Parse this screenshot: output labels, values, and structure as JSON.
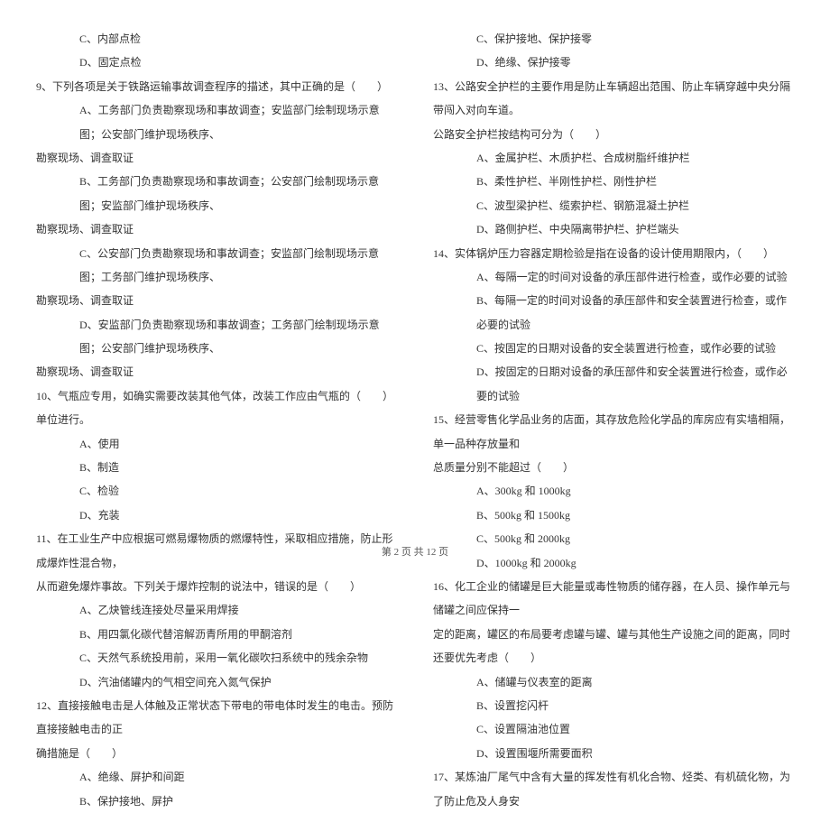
{
  "left": {
    "opt_c": "C、内部点检",
    "opt_d": "D、固定点检",
    "q9": "9、下列各项是关于铁路运输事故调查程序的描述，其中正确的是（　　）",
    "q9_a": "A、工务部门负责勘察现场和事故调查；安监部门绘制现场示意图；公安部门维护现场秩序、",
    "q9_a2": "勘察现场、调查取证",
    "q9_b": "B、工务部门负责勘察现场和事故调查；公安部门绘制现场示意图；安监部门维护现场秩序、",
    "q9_b2": "勘察现场、调查取证",
    "q9_c": "C、公安部门负责勘察现场和事故调查；安监部门绘制现场示意图；工务部门维护现场秩序、",
    "q9_c2": "勘察现场、调查取证",
    "q9_d": "D、安监部门负责勘察现场和事故调查；工务部门绘制现场示意图；公安部门维护现场秩序、",
    "q9_d2": "勘察现场、调查取证",
    "q10": "10、气瓶应专用，如确实需要改装其他气体，改装工作应由气瓶的（　　）单位进行。",
    "q10_a": "A、使用",
    "q10_b": "B、制造",
    "q10_c": "C、检验",
    "q10_d": "D、充装",
    "q11": "11、在工业生产中应根据可燃易爆物质的燃爆特性，采取相应措施，防止形成爆炸性混合物，",
    "q11_2": "从而避免爆炸事故。下列关于爆炸控制的说法中，错误的是（　　）",
    "q11_a": "A、乙炔管线连接处尽量采用焊接",
    "q11_b": "B、用四氯化碳代替溶解沥青所用的甲酮溶剂",
    "q11_c": "C、天然气系统投用前，采用一氧化碳吹扫系统中的残余杂物",
    "q11_d": "D、汽油储罐内的气相空间充入氮气保护",
    "q12": "12、直接接触电击是人体触及正常状态下带电的带电体时发生的电击。预防直接接触电击的正",
    "q12_2": "确措施是（　　）",
    "q12_a": "A、绝缘、屏护和间距",
    "q12_b": "B、保护接地、屏护"
  },
  "right": {
    "q12_c": "C、保护接地、保护接零",
    "q12_d": "D、绝缘、保护接零",
    "q13": "13、公路安全护栏的主要作用是防止车辆超出范围、防止车辆穿越中央分隔带闯入对向车道。",
    "q13_2": "公路安全护栏按结构可分为（　　）",
    "q13_a": "A、金属护栏、木质护栏、合成树脂纤维护栏",
    "q13_b": "B、柔性护栏、半刚性护栏、刚性护栏",
    "q13_c": "C、波型梁护栏、缆索护栏、钢筋混凝土护栏",
    "q13_d": "D、路侧护栏、中央隔离带护栏、护栏端头",
    "q14": "14、实体锅炉压力容器定期检验是指在设备的设计使用期限内，（　　）",
    "q14_a": "A、每隔一定的时间对设备的承压部件进行检查，或作必要的试验",
    "q14_b": "B、每隔一定的时间对设备的承压部件和安全装置进行检查，或作必要的试验",
    "q14_c": "C、按固定的日期对设备的安全装置进行检查，或作必要的试验",
    "q14_d": "D、按固定的日期对设备的承压部件和安全装置进行检查，或作必要的试验",
    "q15": "15、经营零售化学品业务的店面，其存放危险化学品的库房应有实墙相隔，单一品种存放量和",
    "q15_2": "总质量分别不能超过（　　）",
    "q15_a": "A、300kg 和 1000kg",
    "q15_b": "B、500kg 和 1500kg",
    "q15_c": "C、500kg 和 2000kg",
    "q15_d": "D、1000kg 和 2000kg",
    "q16": "16、化工企业的储罐是巨大能量或毒性物质的储存器，在人员、操作单元与储罐之间应保持一",
    "q16_2": "定的距离，罐区的布局要考虑罐与罐、罐与其他生产设施之间的距离，同时还要优先考虑（　　）",
    "q16_a": "A、储罐与仪表室的距离",
    "q16_b": "B、设置挖闪杆",
    "q16_c": "C、设置隔油池位置",
    "q16_d": "D、设置围堰所需要面积",
    "q17": "17、某炼油厂尾气中含有大量的挥发性有机化合物、烃类、有机硫化物，为了防止危及人身安"
  },
  "footer": "第 2 页 共 12 页"
}
